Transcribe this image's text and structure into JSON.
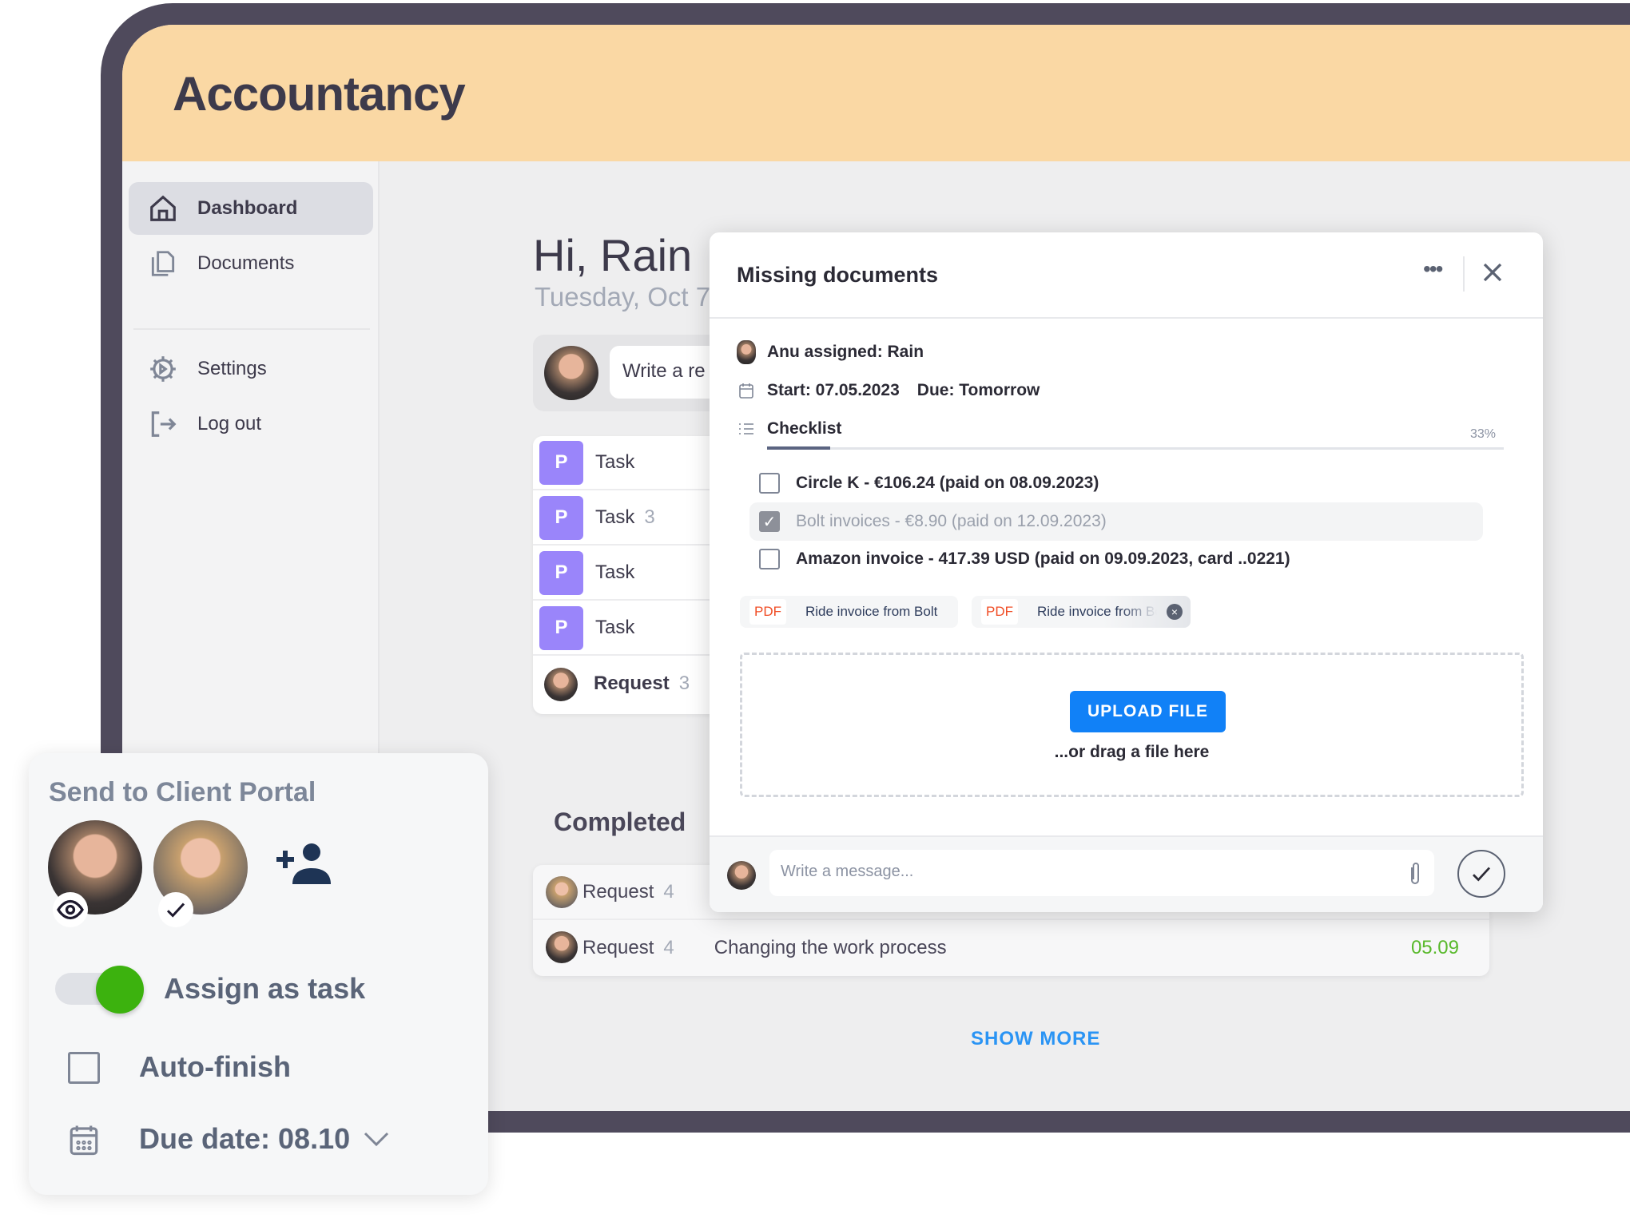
{
  "app": {
    "title": "Accountancy"
  },
  "sidebar": {
    "items": [
      {
        "label": "Dashboard",
        "icon": "home-icon",
        "active": true
      },
      {
        "label": "Documents",
        "icon": "documents-icon"
      },
      {
        "label": "Settings",
        "icon": "gear-icon"
      },
      {
        "label": "Log out",
        "icon": "logout-icon"
      }
    ]
  },
  "main": {
    "greeting": "Hi, Rain",
    "date": "Tuesday, Oct 7",
    "write_placeholder": "Write a re",
    "tasks": [
      {
        "badge": "P",
        "label": "Task",
        "count": ""
      },
      {
        "badge": "P",
        "label": "Task",
        "count": "3"
      },
      {
        "badge": "P",
        "label": "Task",
        "count": ""
      },
      {
        "badge": "P",
        "label": "Task",
        "count": ""
      },
      {
        "label": "Request",
        "count": "3"
      }
    ],
    "completed_heading": "Completed",
    "completed": [
      {
        "label": "Request",
        "count": "4",
        "title": "",
        "date": ""
      },
      {
        "label": "Request",
        "count": "4",
        "title": "Changing the work process",
        "date": "05.09"
      }
    ],
    "show_more": "SHOW MORE"
  },
  "modal": {
    "title": "Missing documents",
    "more_icon": "•••",
    "assigned": "Anu assigned: Rain",
    "start": "Start: 07.05.2023",
    "due": "Due: Tomorrow",
    "checklist_label": "Checklist",
    "progress_pct": 33,
    "progress_text": "33%",
    "items": [
      {
        "text": "Circle K - €106.24 (paid on 08.09.2023)",
        "checked": false
      },
      {
        "text": "Bolt invoices - €8.90 (paid on 12.09.2023)",
        "checked": true
      },
      {
        "text": "Amazon invoice - 417.39 USD (paid on 09.09.2023, card ..0221)",
        "checked": false
      }
    ],
    "attachments": [
      {
        "type": "PDF",
        "name": "Ride invoice from Bolt"
      },
      {
        "type": "PDF",
        "name": "Ride invoice from Bolt"
      }
    ],
    "upload_label": "UPLOAD FILE",
    "drag_text": "...or drag a file here",
    "message_placeholder": "Write a message..."
  },
  "portal": {
    "title": "Send to Client Portal",
    "assign_label": "Assign as task",
    "assign_on": true,
    "autofinish_label": "Auto-finish",
    "autofinish_checked": false,
    "due_label": "Due date: 08.10"
  },
  "colors": {
    "header": "#fad8a4",
    "accent_blue": "#1181f7",
    "toggle_green": "#3cb20e",
    "task_badge": "#9a85fa",
    "date_green": "#59b92c"
  }
}
